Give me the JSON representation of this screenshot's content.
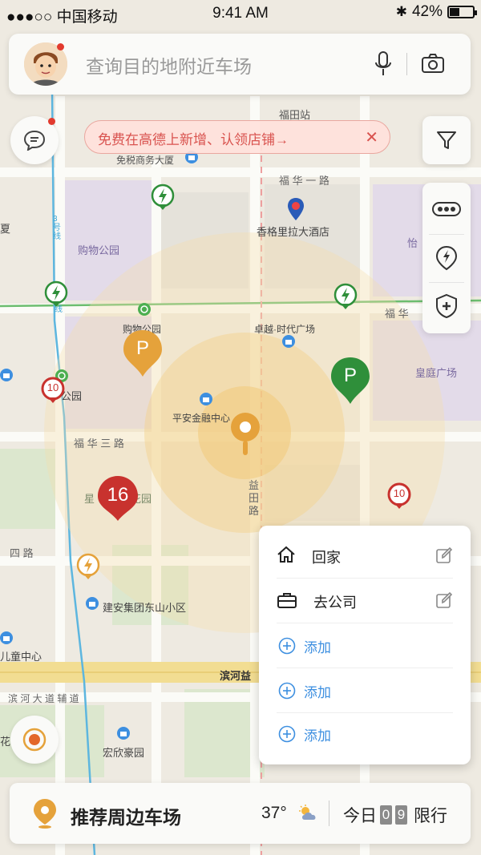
{
  "status_bar": {
    "carrier": "●●●○○ 中国移动",
    "time": "9:41 AM",
    "battery": "42%"
  },
  "search": {
    "placeholder": "查询目的地附近车场"
  },
  "banner": {
    "text": "免费在高德上新增、认领店铺→",
    "close": "✕"
  },
  "map_labels": {
    "futian_station": "福田站",
    "dutyfree": "免税商务大厦",
    "fuhua_1": "福 华 一 路",
    "shangrila": "香格里拉大酒店",
    "mall_park": "购物公园",
    "mall_park2": "购物公园",
    "zhuoyue": "卓越·时代广场",
    "huangting": "皇庭广场",
    "pingan": "平安金融中心",
    "fuhua_3": "福 华 三 路",
    "fuhua_right": "福 华",
    "yitian": "益 田 路",
    "jianan": "建安集团东山小区",
    "binhe_main": "滨河益",
    "binhe": "滨 河 大 道 辅 道",
    "hongxin": "宏欣豪园",
    "children": "儿童中心",
    "si_road": "四 路",
    "park_left": "公园",
    "xing": "星",
    "huayuan": "花园",
    "yi": "怡",
    "hua": "花",
    "ku": "夏",
    "xian": "3号线",
    "xian2": "线"
  },
  "markers": {
    "p1": "P",
    "p2": "P",
    "cluster": "16",
    "limit1": "10",
    "limit2": "10"
  },
  "popup": {
    "home": "回家",
    "company": "去公司",
    "add1": "添加",
    "add2": "添加",
    "add3": "添加"
  },
  "bottom_bar": {
    "title": "推荐周边车场",
    "temperature": "37°",
    "today_label": "今日",
    "digit1": "0",
    "digit2": "9",
    "limit_label": "限行"
  },
  "colors": {
    "accent_blue": "#3d8fe0",
    "banner_red": "#d9534f",
    "parking_orange": "#e5a23b",
    "parking_green": "#2f8f3a"
  }
}
